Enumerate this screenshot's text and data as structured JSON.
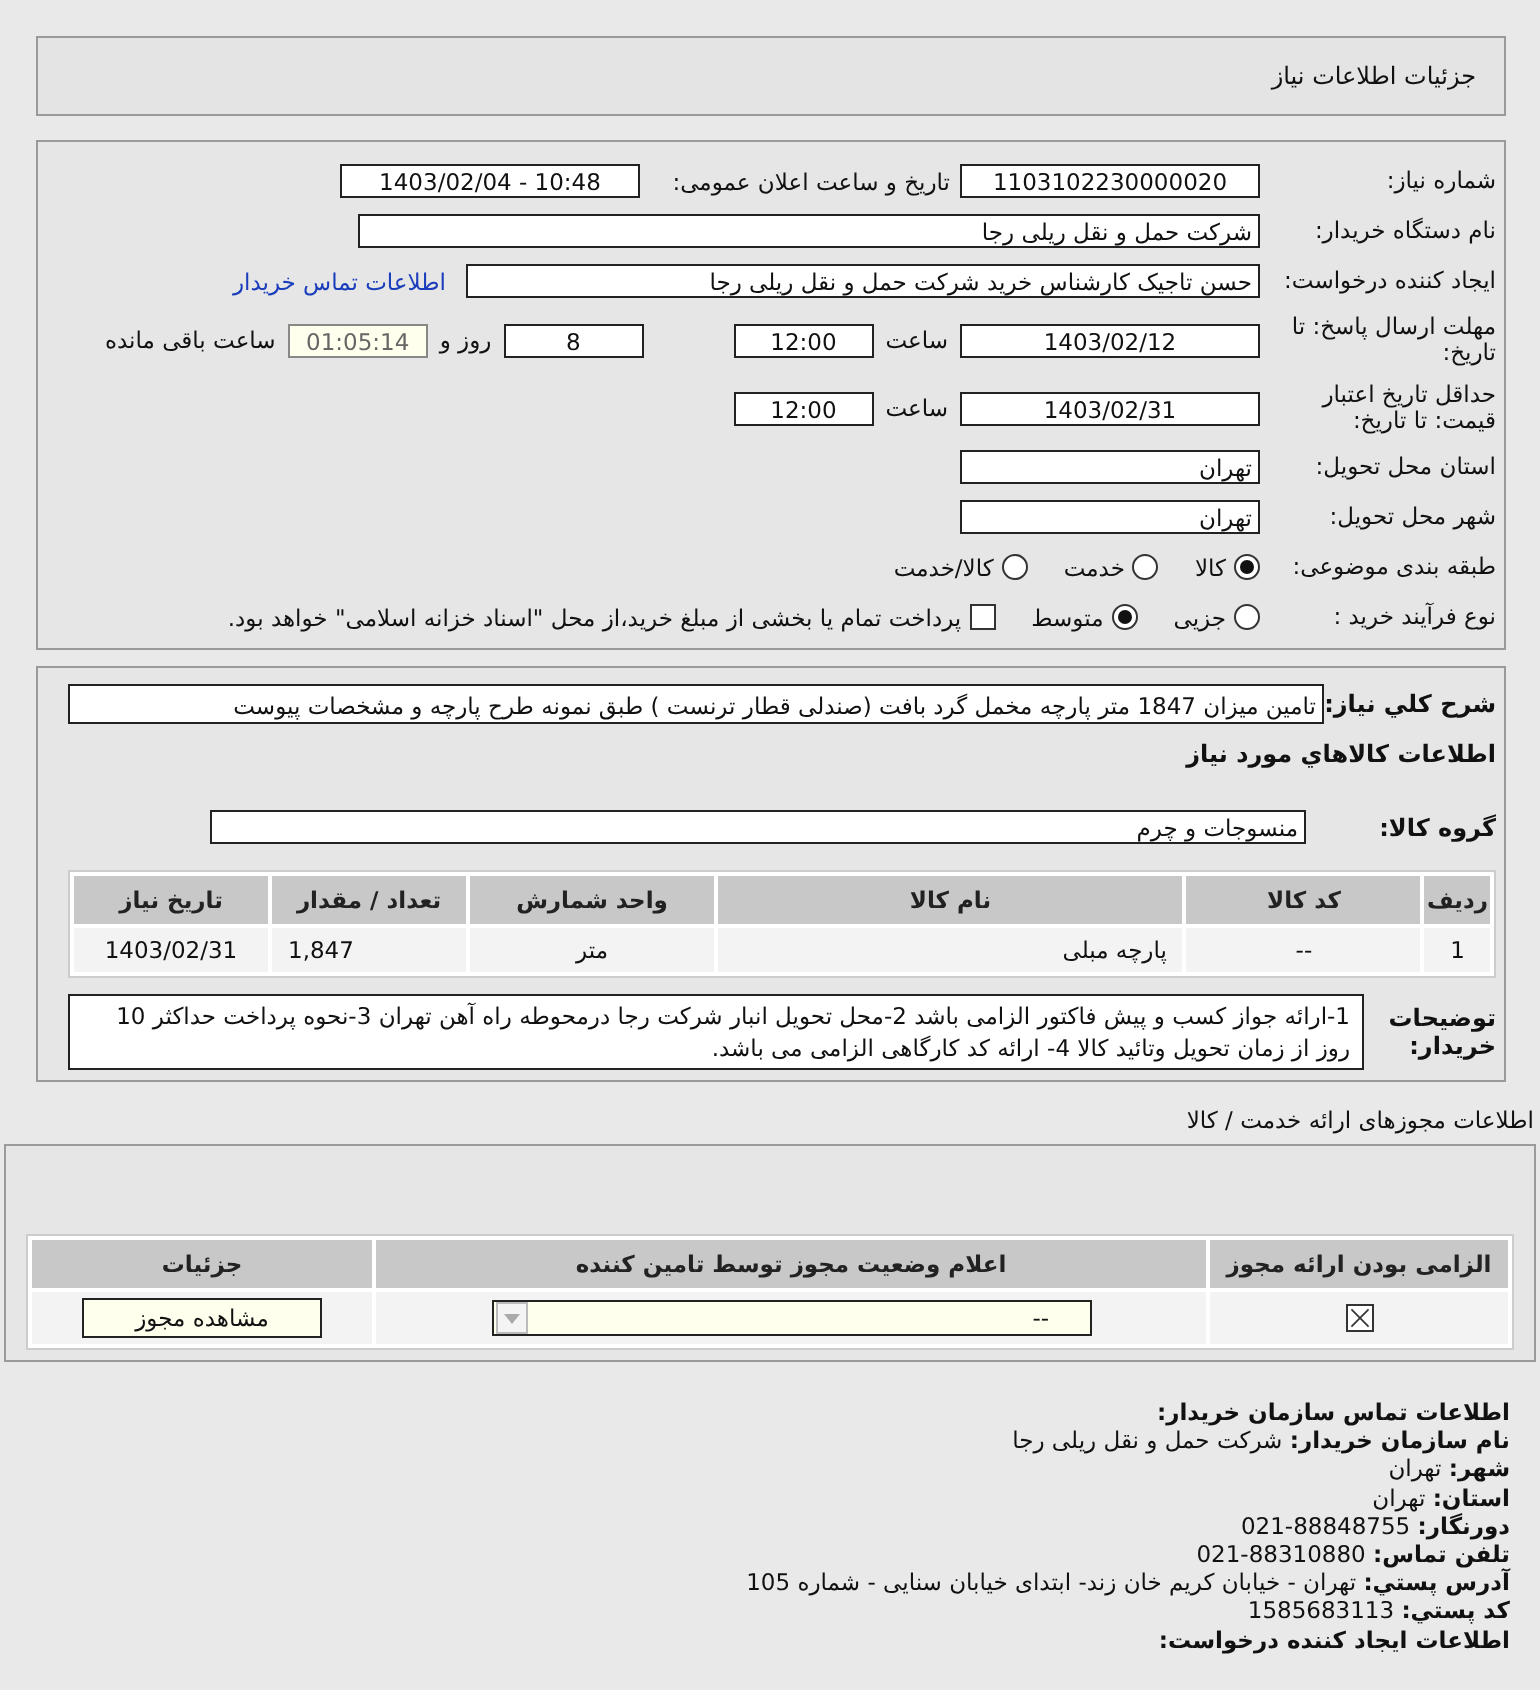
{
  "header": {
    "title": "جزئیات اطلاعات نیاز"
  },
  "details": {
    "need_number": {
      "label": "شماره نیاز:",
      "value": "1103102230000020"
    },
    "announce": {
      "label": "تاریخ و ساعت اعلان عمومی:",
      "value": "1403/02/04 - 10:48"
    },
    "buyer": {
      "label": "نام دستگاه خریدار:",
      "value": "شرکت حمل و نقل ریلی رجا"
    },
    "requester": {
      "label": "ایجاد کننده درخواست:",
      "value": "حسن تاجیک کارشناس خرید شرکت حمل و نقل ریلی رجا",
      "link": "اطلاعات تماس خریدار"
    },
    "deadline": {
      "label": "مهلت ارسال پاسخ: تا تاریخ:",
      "date": "1403/02/12",
      "time_label": "ساعت",
      "time": "12:00",
      "days": "8",
      "days_label": "روز و",
      "remaining": "01:05:14",
      "remaining_label": "ساعت باقی مانده"
    },
    "validity": {
      "label": "حداقل تاریخ اعتبار قیمت: تا تاریخ:",
      "date": "1403/02/31",
      "time_label": "ساعت",
      "time": "12:00"
    },
    "province": {
      "label": "استان محل تحویل:",
      "value": "تهران"
    },
    "city": {
      "label": "شهر محل تحویل:",
      "value": "تهران"
    },
    "category": {
      "label": "طبقه بندی موضوعی:",
      "options": [
        {
          "label": "کالا",
          "selected": true
        },
        {
          "label": "خدمت",
          "selected": false
        },
        {
          "label": "کالا/خدمت",
          "selected": false
        }
      ]
    },
    "process": {
      "label": "نوع فرآیند خرید :",
      "options": [
        {
          "label": "جزیی",
          "selected": false
        },
        {
          "label": "متوسط",
          "selected": true
        }
      ],
      "treasury": {
        "label": "پرداخت تمام یا بخشی از مبلغ خرید،از محل \"اسناد خزانه اسلامی\" خواهد بود.",
        "checked": false
      }
    }
  },
  "description": {
    "label": "شرح كلي نياز:",
    "value": "تامین میزان 1847 متر پارچه مخمل گرد بافت (صندلی قطار ترنست ) طبق نمونه طرح پارچه و مشخصات پیوست"
  },
  "goods": {
    "heading": "اطلاعات كالاهاي مورد نياز",
    "group_label": "گروه کالا:",
    "group": "منسوجات و چرم",
    "columns": [
      "ردیف",
      "کد کالا",
      "نام کالا",
      "واحد شمارش",
      "تعداد / مقدار",
      "تاریخ نیاز"
    ],
    "rows": [
      [
        "1",
        "--",
        "پارچه مبلی",
        "متر",
        "1,847",
        "1403/02/31"
      ]
    ]
  },
  "notes": {
    "label": "توضیحات خریدار:",
    "value": "1-ارائه جواز کسب و پیش فاکتور الزامی باشد 2-محل تحویل انبار شرکت رجا درمحوطه راه آهن تهران 3-نحوه پرداخت حداکثر 10 روز از زمان تحویل وتائید کالا 4- ارائه کد کارگاهی الزامی می باشد."
  },
  "licenses": {
    "title": "اطلاعات مجوزهای ارائه خدمت / کالا",
    "columns": [
      "الزامی بودن ارائه مجوز",
      "اعلام وضعیت مجوز توسط تامین کننده",
      "جزئیات"
    ],
    "rows": [
      {
        "required": true,
        "status": "--",
        "button": "مشاهده مجوز"
      }
    ]
  },
  "contact": {
    "lines": [
      "**اطلاعات تماس سازمان خریدار:**",
      "**نام سازمان خریدار:** شرکت حمل و نقل ریلی رجا",
      "**شهر:** تهران",
      "**استان:** تهران",
      "**دورنگار:** 88848755-021",
      "**تلفن تماس:** 88310880-021",
      "**آدرس پستي:** تهران - خیابان کریم خان زند- ابتدای خیابان سنایی - شماره 105",
      "**کد پستي:** 1585683113",
      "**اطلاعات ایجاد کننده درخواست:**"
    ]
  }
}
